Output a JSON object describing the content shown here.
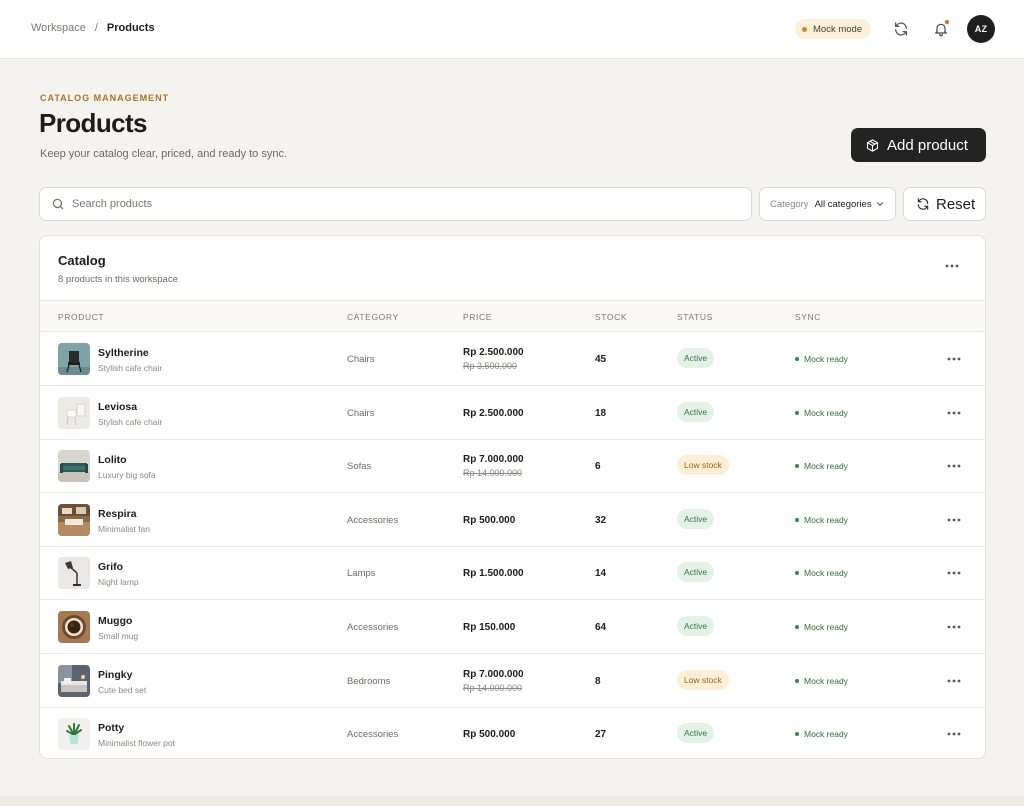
{
  "breadcrumb": {
    "root": "Workspace",
    "separator": "/",
    "current": "Products"
  },
  "topbar": {
    "mock_mode_label": "Mock mode",
    "avatar_initials": "AZ"
  },
  "header": {
    "eyebrow": "CATALOG MANAGEMENT",
    "title": "Products",
    "subtitle": "Keep your catalog clear, priced, and ready to sync.",
    "add_button_label": "Add product"
  },
  "filters": {
    "search_placeholder": "Search products",
    "category_label": "Category",
    "category_value": "All categories",
    "reset_label": "Reset"
  },
  "catalog": {
    "title": "Catalog",
    "subtitle": "8 products in this workspace",
    "columns": {
      "product": "PRODUCT",
      "category": "CATEGORY",
      "price": "PRICE",
      "stock": "STOCK",
      "status": "STATUS",
      "sync": "SYNC"
    },
    "rows": [
      {
        "name": "Syltherine",
        "desc": "Stylish cafe chair",
        "category": "Chairs",
        "price": "Rp 2.500.000",
        "old_price": "Rp 3.500.000",
        "stock": "45",
        "status": "Active",
        "status_kind": "active",
        "sync": "Mock ready",
        "thumb": "chair-dark"
      },
      {
        "name": "Leviosa",
        "desc": "Stylish cafe chair",
        "category": "Chairs",
        "price": "Rp 2.500.000",
        "old_price": "",
        "stock": "18",
        "status": "Active",
        "status_kind": "active",
        "sync": "Mock ready",
        "thumb": "chair-white"
      },
      {
        "name": "Lolito",
        "desc": "Luxury big sofa",
        "category": "Sofas",
        "price": "Rp 7.000.000",
        "old_price": "Rp 14.000.000",
        "stock": "6",
        "status": "Low stock",
        "status_kind": "low",
        "sync": "Mock ready",
        "thumb": "sofa"
      },
      {
        "name": "Respira",
        "desc": "Minimalist fan",
        "category": "Accessories",
        "price": "Rp 500.000",
        "old_price": "",
        "stock": "32",
        "status": "Active",
        "status_kind": "active",
        "sync": "Mock ready",
        "thumb": "room"
      },
      {
        "name": "Grifo",
        "desc": "Night lamp",
        "category": "Lamps",
        "price": "Rp 1.500.000",
        "old_price": "",
        "stock": "14",
        "status": "Active",
        "status_kind": "active",
        "sync": "Mock ready",
        "thumb": "lamp"
      },
      {
        "name": "Muggo",
        "desc": "Small mug",
        "category": "Accessories",
        "price": "Rp 150.000",
        "old_price": "",
        "stock": "64",
        "status": "Active",
        "status_kind": "active",
        "sync": "Mock ready",
        "thumb": "mug"
      },
      {
        "name": "Pingky",
        "desc": "Cute bed set",
        "category": "Bedrooms",
        "price": "Rp 7.000.000",
        "old_price": "Rp 14.000.000",
        "stock": "8",
        "status": "Low stock",
        "status_kind": "low",
        "sync": "Mock ready",
        "thumb": "bed"
      },
      {
        "name": "Potty",
        "desc": "Minimalist flower pot",
        "category": "Accessories",
        "price": "Rp 500.000",
        "old_price": "",
        "stock": "27",
        "status": "Active",
        "status_kind": "active",
        "sync": "Mock ready",
        "thumb": "plant"
      }
    ]
  },
  "colors": {
    "accent_dark": "#232323",
    "eyebrow": "#a67624",
    "active_bg": "#e4f1e7",
    "active_text": "#2e7a46",
    "low_bg": "#fcefd6",
    "low_text": "#9a6615",
    "mock_pill": "#fbf0da"
  },
  "icons": {
    "refresh": "refresh-icon",
    "bell": "bell-icon",
    "box": "box-icon",
    "search": "search-icon",
    "chevron": "chevron-down-icon",
    "more": "more-icon"
  }
}
